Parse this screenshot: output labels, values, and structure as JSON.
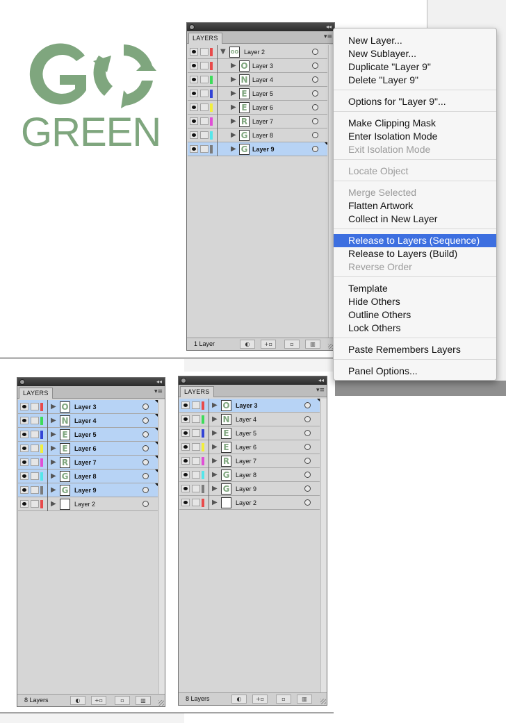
{
  "logo": {
    "line1": "GO",
    "line2": "GREEN",
    "color": "#7fa67e"
  },
  "panel_top": {
    "tab": "LAYERS",
    "count": "1 Layer",
    "layers": [
      {
        "name": "Layer 2",
        "color": "#e84a4a",
        "thumb": "GO",
        "expanded": true,
        "selected": false
      },
      {
        "name": "Layer 3",
        "color": "#e84a4a",
        "thumb": "O",
        "selected": false
      },
      {
        "name": "Layer 4",
        "color": "#3ddc5a",
        "thumb": "N",
        "selected": false
      },
      {
        "name": "Layer 5",
        "color": "#3344d6",
        "thumb": "E",
        "selected": false
      },
      {
        "name": "Layer 6",
        "color": "#f2ef3b",
        "thumb": "E",
        "selected": false
      },
      {
        "name": "Layer 7",
        "color": "#e04fd6",
        "thumb": "R",
        "selected": false
      },
      {
        "name": "Layer 8",
        "color": "#55e6ea",
        "thumb": "G",
        "selected": false
      },
      {
        "name": "Layer 9",
        "color": "#7b7b7b",
        "thumb": "G",
        "selected": true
      }
    ]
  },
  "context_menu": {
    "items": [
      {
        "label": "New Layer...",
        "disabled": false
      },
      {
        "label": "New Sublayer...",
        "disabled": false
      },
      {
        "label": "Duplicate \"Layer 9\"",
        "disabled": false
      },
      {
        "label": "Delete \"Layer 9\"",
        "disabled": false
      },
      {
        "label": "Options for \"Layer 9\"...",
        "disabled": false
      },
      {
        "label": "Make Clipping Mask",
        "disabled": false
      },
      {
        "label": "Enter Isolation Mode",
        "disabled": false
      },
      {
        "label": "Exit Isolation Mode",
        "disabled": true
      },
      {
        "label": "Locate Object",
        "disabled": true
      },
      {
        "label": "Merge Selected",
        "disabled": true
      },
      {
        "label": "Flatten Artwork",
        "disabled": false
      },
      {
        "label": "Collect in New Layer",
        "disabled": false
      },
      {
        "label": "Release to Layers (Sequence)",
        "disabled": false,
        "highlighted": true
      },
      {
        "label": "Release to Layers (Build)",
        "disabled": false
      },
      {
        "label": "Reverse Order",
        "disabled": true
      },
      {
        "label": "Template",
        "disabled": false
      },
      {
        "label": "Hide Others",
        "disabled": false
      },
      {
        "label": "Outline Others",
        "disabled": false
      },
      {
        "label": "Lock Others",
        "disabled": false
      },
      {
        "label": "Paste Remembers Layers",
        "disabled": false
      },
      {
        "label": "Panel Options...",
        "disabled": false
      }
    ]
  },
  "panel_left": {
    "tab": "LAYERS",
    "count": "8 Layers",
    "layers": [
      {
        "name": "Layer 3",
        "color": "#e84a4a",
        "thumb": "O",
        "selected": true
      },
      {
        "name": "Layer 4",
        "color": "#3ddc5a",
        "thumb": "N",
        "selected": true
      },
      {
        "name": "Layer 5",
        "color": "#3344d6",
        "thumb": "E",
        "selected": true
      },
      {
        "name": "Layer 6",
        "color": "#f2ef3b",
        "thumb": "E",
        "selected": true
      },
      {
        "name": "Layer 7",
        "color": "#e04fd6",
        "thumb": "R",
        "selected": true
      },
      {
        "name": "Layer 8",
        "color": "#55e6ea",
        "thumb": "G",
        "selected": true
      },
      {
        "name": "Layer 9",
        "color": "#7b7b7b",
        "thumb": "G",
        "selected": true
      },
      {
        "name": "Layer 2",
        "color": "#e84a4a",
        "thumb": "",
        "selected": false
      }
    ]
  },
  "panel_right": {
    "tab": "LAYERS",
    "count": "8 Layers",
    "layers": [
      {
        "name": "Layer 3",
        "color": "#e84a4a",
        "thumb": "O",
        "selected": true
      },
      {
        "name": "Layer 4",
        "color": "#3ddc5a",
        "thumb": "N",
        "selected": false
      },
      {
        "name": "Layer 5",
        "color": "#3344d6",
        "thumb": "E",
        "selected": false
      },
      {
        "name": "Layer 6",
        "color": "#f2ef3b",
        "thumb": "E",
        "selected": false
      },
      {
        "name": "Layer 7",
        "color": "#e04fd6",
        "thumb": "R",
        "selected": false
      },
      {
        "name": "Layer 8",
        "color": "#55e6ea",
        "thumb": "G",
        "selected": false
      },
      {
        "name": "Layer 9",
        "color": "#7b7b7b",
        "thumb": "G",
        "selected": false
      },
      {
        "name": "Layer 2",
        "color": "#e84a4a",
        "thumb": "",
        "selected": false
      }
    ]
  },
  "footer_icons": [
    "make-clipping-mask-icon",
    "create-sublayer-icon",
    "new-layer-icon",
    "trash-icon"
  ]
}
